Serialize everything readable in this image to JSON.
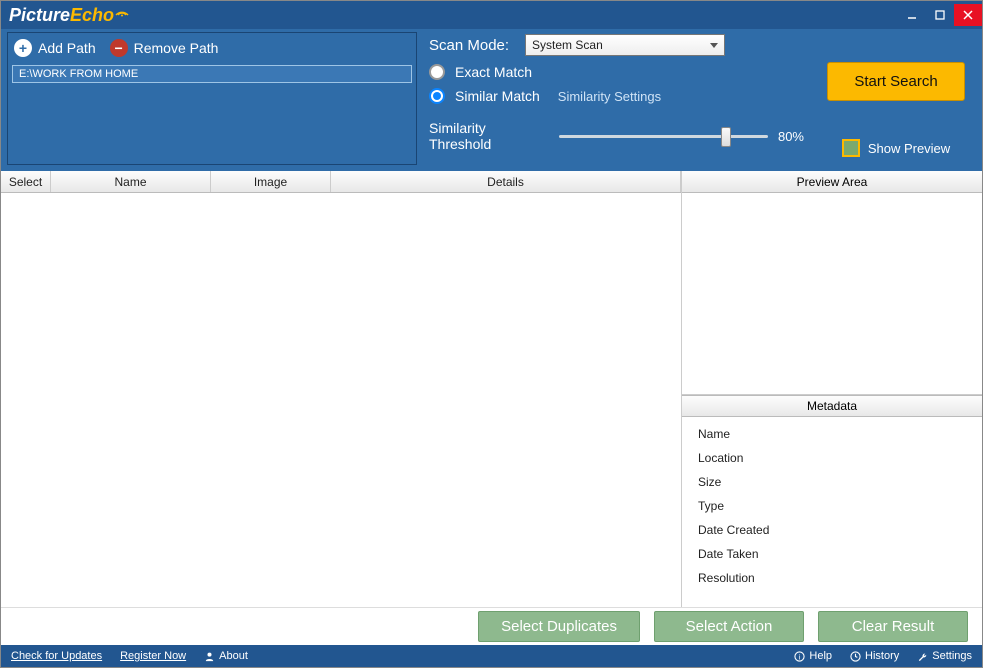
{
  "app": {
    "name_part1": "Picture",
    "name_part2": "Echo"
  },
  "paths": {
    "add_label": "Add Path",
    "remove_label": "Remove Path",
    "entries": [
      "E:\\WORK FROM HOME"
    ]
  },
  "scan": {
    "mode_label": "Scan Mode:",
    "mode_value": "System Scan",
    "exact_label": "Exact Match",
    "similar_label": "Similar Match",
    "similar_selected": true,
    "settings_label": "Similarity Settings",
    "threshold_label": "Similarity Threshold",
    "threshold_pct": "80%"
  },
  "actions_top": {
    "start": "Start Search",
    "show_preview": "Show Preview"
  },
  "columns": {
    "select": "Select",
    "name": "Name",
    "image": "Image",
    "details": "Details"
  },
  "right": {
    "preview_header": "Preview Area",
    "metadata_header": "Metadata",
    "fields": [
      "Name",
      "Location",
      "Size",
      "Type",
      "Date Created",
      "Date Taken",
      "Resolution"
    ]
  },
  "actions_bottom": {
    "select_dup": "Select Duplicates",
    "select_action": "Select Action",
    "clear": "Clear Result"
  },
  "status": {
    "updates": "Check for Updates",
    "register": "Register Now",
    "about": "About",
    "help": "Help",
    "history": "History",
    "settings": "Settings"
  }
}
